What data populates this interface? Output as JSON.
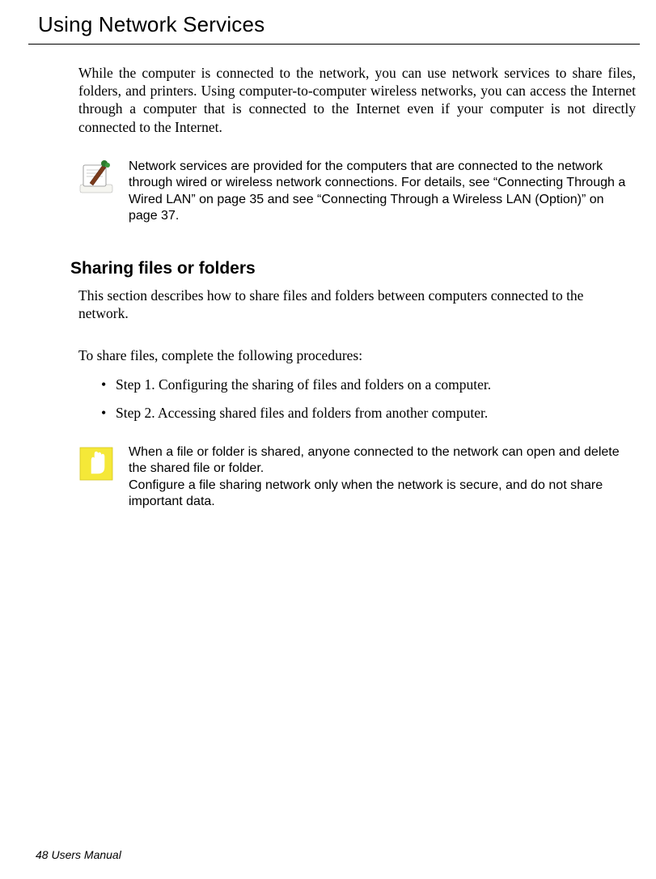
{
  "page": {
    "title": "Using Network Services",
    "intro": "While the computer is connected to the network, you can use network services to share files, folders, and printers. Using computer-to-computer wireless networks, you can access the Internet through a computer that is connected to the Internet even if your computer is not directly connected to the Internet.",
    "note": {
      "icon": "note-pen-icon",
      "text": "Network services are provided for the computers that are connected to the network through wired or wireless network connections. For details, see “Connecting Through a Wired LAN” on page 35 and see “Connecting Through a Wireless LAN (Option)” on page 37."
    },
    "section": {
      "heading": "Sharing files or folders",
      "intro": "This section describes how to share files and folders between computers connected to the network.",
      "procedures_lead": "To share files, complete the following procedures:",
      "steps": [
        "Step 1. Configuring the sharing of files and folders on a computer.",
        "Step 2. Accessing shared files and folders from another computer."
      ]
    },
    "caution": {
      "icon": "caution-hand-icon",
      "line1": "When a file or folder is shared, anyone connected to the network can open and delete the shared file or folder.",
      "line2": "Configure a file sharing network only when the network is secure, and do not share important data."
    },
    "footer": "48  Users Manual"
  }
}
